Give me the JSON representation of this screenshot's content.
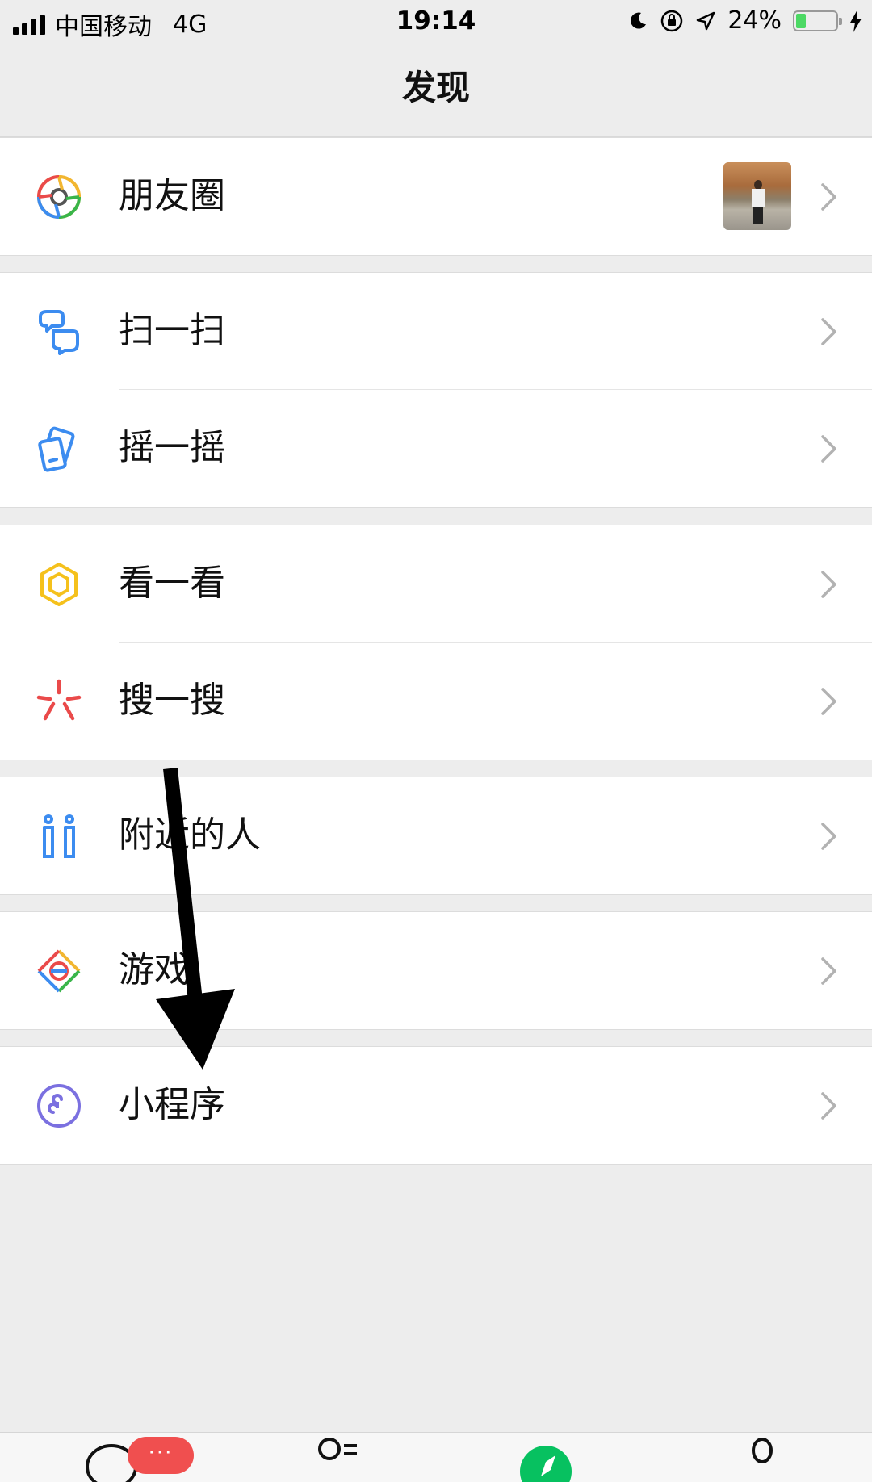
{
  "status_bar": {
    "carrier": "中国移动",
    "network": "4G",
    "time": "19:14",
    "battery_percent": "24%",
    "battery_level": 0.24
  },
  "nav": {
    "title": "发现"
  },
  "menu": {
    "moments": {
      "label": "朋友圈",
      "icon": "moments-icon"
    },
    "scan": {
      "label": "扫一扫",
      "icon": "scan-icon"
    },
    "shake": {
      "label": "摇一摇",
      "icon": "shake-icon"
    },
    "top_stories": {
      "label": "看一看",
      "icon": "top-stories-icon"
    },
    "search": {
      "label": "搜一搜",
      "icon": "search-icon"
    },
    "nearby": {
      "label": "附近的人",
      "icon": "people-nearby-icon"
    },
    "games": {
      "label": "游戏",
      "icon": "games-icon"
    },
    "mini_programs": {
      "label": "小程序",
      "icon": "mini-program-icon"
    }
  },
  "tabbar": {
    "badge": "···",
    "active_color": "#07c160"
  }
}
